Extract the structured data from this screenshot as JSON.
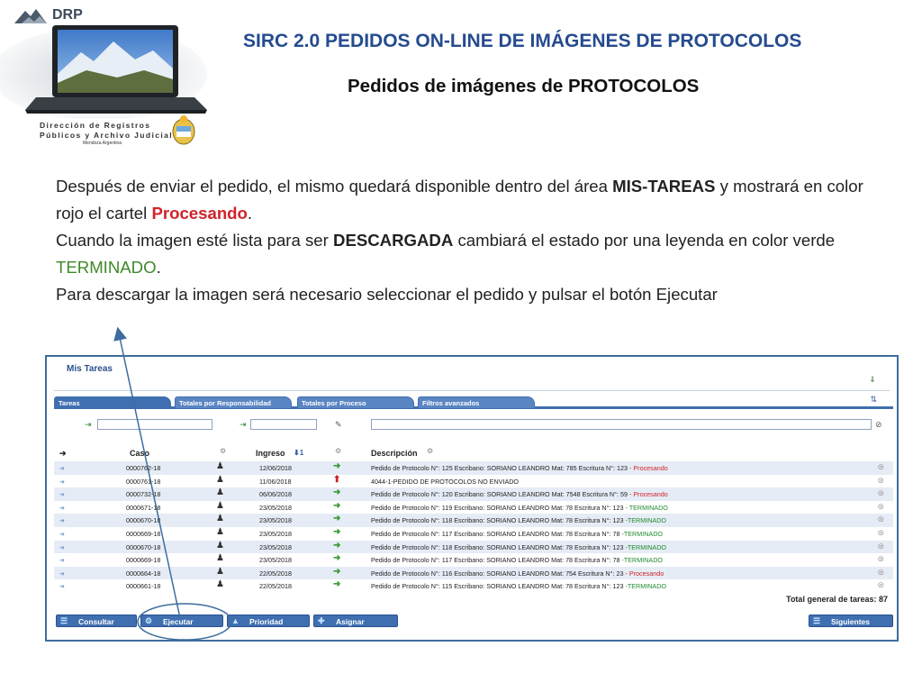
{
  "logo": {
    "brand": "DRP",
    "org_line1": "Dirección de Registros",
    "org_line2": "Públicos y Archivo Judicial",
    "org_sub": "Mendoza Argentina"
  },
  "title": "SIRC 2.0 PEDIDOS ON-LINE DE IMÁGENES DE PROTOCOLOS",
  "subtitle": "Pedidos de imágenes de PROTOCOLOS",
  "paragraph": {
    "p1_a": "Después de enviar el pedido, el mismo quedará disponible dentro del área ",
    "p1_b": "MIS-TAREAS",
    "p1_c": " y mostrará en color rojo el cartel ",
    "p1_d": "Procesando",
    "p1_e": ".",
    "p2_a": "Cuando la imagen esté lista para ser ",
    "p2_b": "DESCARGADA",
    "p2_c": " cambiará el estado por una leyenda en color verde ",
    "p2_d": "TERMINADO",
    "p2_e": ".",
    "p3": "Para descargar la imagen será necesario seleccionar el pedido y pulsar el botón Ejecutar"
  },
  "app": {
    "panel_title": "Mis Tareas",
    "tabs": [
      "Tareas",
      "Totales por Responsabilidad",
      "Totales por Proceso",
      "Filtros avanzados"
    ],
    "columns": {
      "caso": "Caso",
      "ingreso": "Ingreso",
      "descripcion": "Descripción"
    },
    "rows": [
      {
        "caso": "0000762-18",
        "fecha": "12/06/2018",
        "status": "ok",
        "desc": "Pedido de Protocolo N°: 125 Escribano: SORIANO LEANDRO Mat: 785 Escritura N°: 123 ",
        "estado": "- Procesando",
        "estado_color": "red"
      },
      {
        "caso": "0000761-18",
        "fecha": "11/06/2018",
        "status": "err",
        "desc": "4044-1-PEDIDO DE PROTOCOLOS NO ENVIADO",
        "estado": "",
        "estado_color": ""
      },
      {
        "caso": "0000732-18",
        "fecha": "06/06/2018",
        "status": "ok",
        "desc": "Pedido de Protocolo N°: 120 Escribano: SORIANO LEANDRO Mat: 7548 Escritura N°: 59 ",
        "estado": "- Procesando",
        "estado_color": "red"
      },
      {
        "caso": "0000671-18",
        "fecha": "23/05/2018",
        "status": "ok",
        "desc": "Pedido de Protocolo N°: 119 Escribano: SORIANO LEANDRO Mat: 78 Escritura N°: 123 ",
        "estado": "- TERMINADO",
        "estado_color": "green"
      },
      {
        "caso": "0000670-18",
        "fecha": "23/05/2018",
        "status": "ok",
        "desc": "Pedido de Protocolo N°: 118 Escribano: SORIANO LEANDRO Mat: 78 Escritura N°: 123 ",
        "estado": "-TERMINADO",
        "estado_color": "green"
      },
      {
        "caso": "0000669-18",
        "fecha": "23/05/2018",
        "status": "ok",
        "desc": "Pedido de Protocolo N°: 117 Escribano: SORIANO LEANDRO Mat: 78 Escritura N°: 78 ",
        "estado": "-TERMINADO",
        "estado_color": "green"
      },
      {
        "caso": "0000670-18",
        "fecha": "23/05/2018",
        "status": "ok",
        "desc": "Pedido de Protocolo N°: 118 Escribano: SORIANO LEANDRO Mat: 78 Escritura N°: 123 ",
        "estado": "-TERMINADO",
        "estado_color": "green"
      },
      {
        "caso": "0000669-18",
        "fecha": "23/05/2018",
        "status": "ok",
        "desc": "Pedido de Protocolo N°: 117 Escribano: SORIANO LEANDRO Mat: 78 Escritura N°: 78 ",
        "estado": "-TERMINADO",
        "estado_color": "green"
      },
      {
        "caso": "0000664-18",
        "fecha": "22/05/2018",
        "status": "ok",
        "desc": "Pedido de Protocolo N°: 116 Escribano: SORIANO LEANDRO Mat: 754 Escritura N°: 23 ",
        "estado": "- Procesando",
        "estado_color": "red"
      },
      {
        "caso": "0000661-18",
        "fecha": "22/05/2018",
        "status": "ok",
        "desc": "Pedido de Protocolo N°: 115 Escribano: SORIANO LEANDRO Mat: 78 Escritura N°: 123 ",
        "estado": "-TERMINADO",
        "estado_color": "green"
      }
    ],
    "total": "Total general de tareas: 87",
    "buttons": {
      "consultar": "Consultar",
      "ejecutar": "Ejecutar",
      "prioridad": "Prioridad",
      "asignar": "Asignar",
      "siguientes": "Siguientes"
    }
  },
  "colors": {
    "title_blue": "#254b8f",
    "red": "#d0232a",
    "green": "#3f8a2a",
    "annotation": "#3d6d9e"
  }
}
